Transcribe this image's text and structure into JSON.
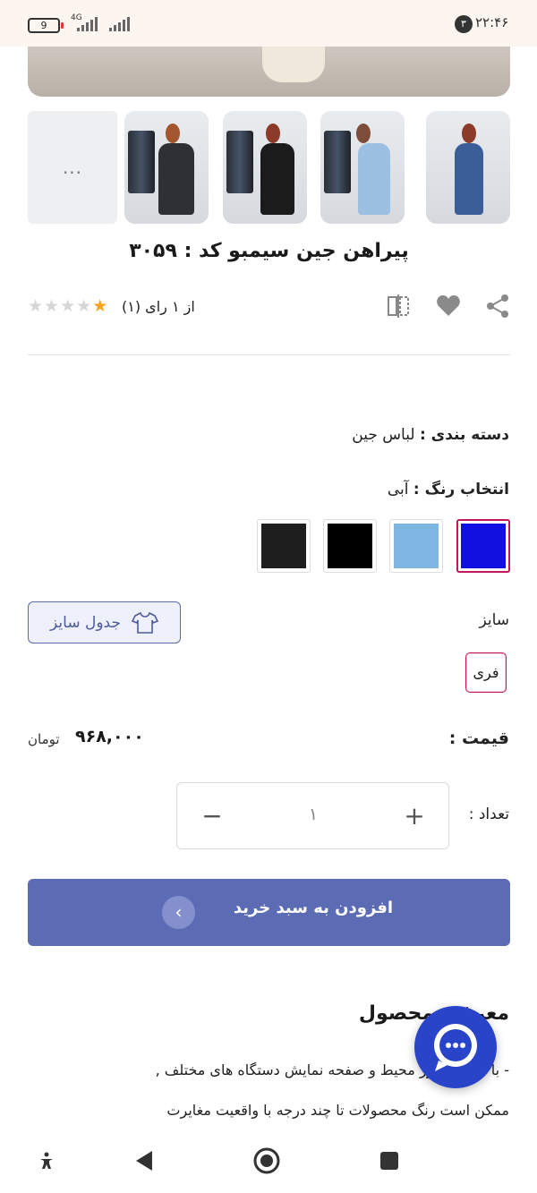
{
  "status_bar": {
    "battery": "9",
    "network": "4G",
    "notification_count": "۳",
    "time": "۲۲:۴۶"
  },
  "gallery": {
    "more_label": "...",
    "thumbnails": [
      "blue-dress-front",
      "light-blue-dress",
      "black-dress-bag",
      "dark-dress",
      "more"
    ]
  },
  "product": {
    "title": "پیراهن جین سیمبو کد : ۳۰۵۹",
    "rating_text": "از ۱ رای (۱)",
    "stars_filled": 1,
    "stars_total": 5,
    "category_label": "دسته بندی :",
    "category_value": "لباس جین",
    "color_label": "انتخاب رنگ :",
    "color_value": "آبی",
    "colors": [
      "#1010e0",
      "#7cb6e1",
      "#000000",
      "#1e1e1e"
    ],
    "size_label": "سایز",
    "size_table_label": "جدول سایز",
    "size_option": "فری",
    "price_label": "قیمت :",
    "price_value": "۹۶۸,۰۰۰",
    "price_unit": "تومان",
    "quantity_label": "تعداد :",
    "quantity_value": "۱",
    "add_to_cart_label": "افزودن به سبد خرید"
  },
  "description": {
    "heading": "معرفی محصول",
    "line1": "- با توجه به نور محیط و صفحه نمایش دستگاه های مختلف ,",
    "line2": "ممکن است رنگ محصولات تا چند درجه با واقعیت مغایرت"
  },
  "colors": {
    "accent": "#5b6cb4",
    "selected_border": "#c2185b",
    "chat_fab": "#2a44c9",
    "star": "#f7a21b"
  }
}
